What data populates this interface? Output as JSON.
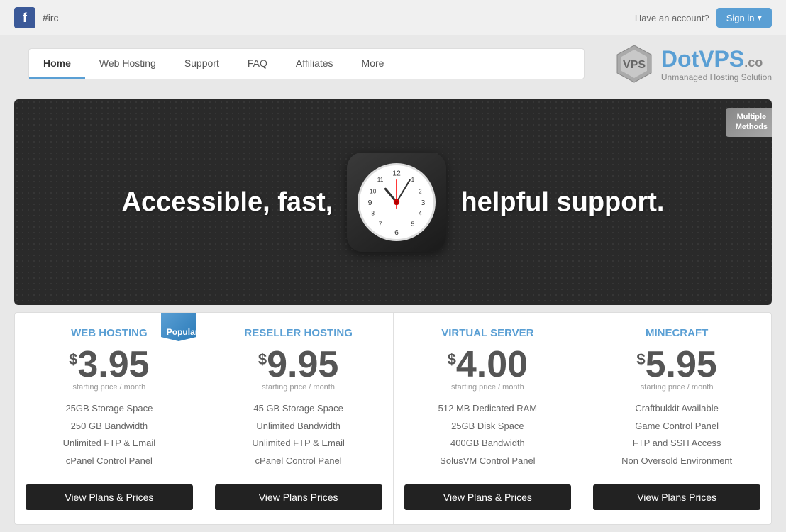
{
  "topbar": {
    "irc": "#irc",
    "have_account": "Have an account?",
    "sign_in": "Sign in"
  },
  "logo": {
    "title_part1": "Dot",
    "title_part2": "VPS",
    "title_tld": ".co",
    "subtitle": "Unmanaged Hosting Solution"
  },
  "nav": {
    "items": [
      {
        "label": "Home",
        "active": true
      },
      {
        "label": "Web Hosting",
        "active": false
      },
      {
        "label": "Support",
        "active": false
      },
      {
        "label": "FAQ",
        "active": false
      },
      {
        "label": "Affiliates",
        "active": false
      },
      {
        "label": "More",
        "active": false
      }
    ]
  },
  "banner": {
    "text_left": "Accessible, fast,",
    "text_right": "helpful support.",
    "ribbon_line1": "Multiple",
    "ribbon_line2": "Methods"
  },
  "plans": [
    {
      "id": "web-hosting",
      "title": "WEB HOSTING",
      "popular": true,
      "price_dollar": "$",
      "price": "3.95",
      "price_sub": "starting price / month",
      "features": [
        "25GB Storage Space",
        "250 GB Bandwidth",
        "Unlimited FTP & Email",
        "cPanel Control Panel"
      ],
      "btn_label": "View Plans & Prices"
    },
    {
      "id": "reseller-hosting",
      "title": "RESELLER HOSTING",
      "popular": false,
      "price_dollar": "$",
      "price": "9.95",
      "price_sub": "starting price / month",
      "features": [
        "45 GB Storage Space",
        "Unlimited Bandwidth",
        "Unlimited FTP & Email",
        "cPanel Control Panel"
      ],
      "btn_label": "View Plans & Prices"
    },
    {
      "id": "virtual-server",
      "title": "VIRTUAL SERVER",
      "popular": false,
      "price_dollar": "$",
      "price": "4.00",
      "price_sub": "starting price / month",
      "features": [
        "512 MB Dedicated RAM",
        "25GB Disk Space",
        "400GB Bandwidth",
        "SolusVM Control Panel"
      ],
      "btn_label": "View Plans & Prices"
    },
    {
      "id": "minecraft",
      "title": "MINECRAFT",
      "popular": false,
      "price_dollar": "$",
      "price": "5.95",
      "price_sub": "starting price / month",
      "features": [
        "Craftbukkit Available",
        "Game Control Panel",
        "FTP and SSH Access",
        "Non Oversold Environment"
      ],
      "btn_label": "View Plans & Prices"
    }
  ]
}
